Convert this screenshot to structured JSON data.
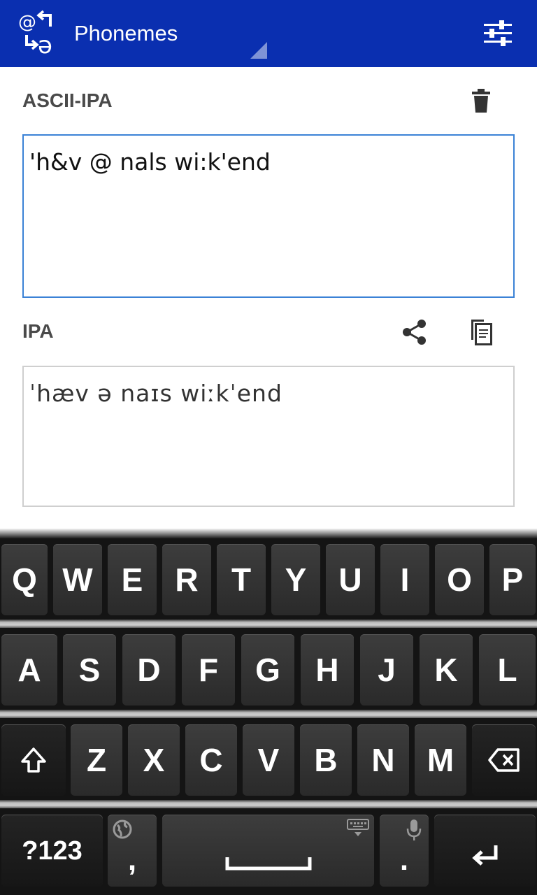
{
  "app_bar": {
    "title": "Phonemes",
    "logo_top": "@",
    "logo_bottom": "ə"
  },
  "ascii_section": {
    "label": "ASCII-IPA",
    "value": "'h&v @ nals wi:k'end"
  },
  "ipa_section": {
    "label": "IPA",
    "value": "ˈhæv ə naɪs wiːkˈend"
  },
  "keyboard": {
    "row1": [
      "Q",
      "W",
      "E",
      "R",
      "T",
      "Y",
      "U",
      "I",
      "O",
      "P"
    ],
    "row2": [
      "A",
      "S",
      "D",
      "F",
      "G",
      "H",
      "J",
      "K",
      "L"
    ],
    "row3": [
      "Z",
      "X",
      "C",
      "V",
      "B",
      "N",
      "M"
    ],
    "symbols_label": "?123",
    "comma_label": ",",
    "period_label": "."
  },
  "colors": {
    "app_bar": "#0a2fb0",
    "input_border": "#3b82d6",
    "output_border": "#cfcfcf"
  }
}
